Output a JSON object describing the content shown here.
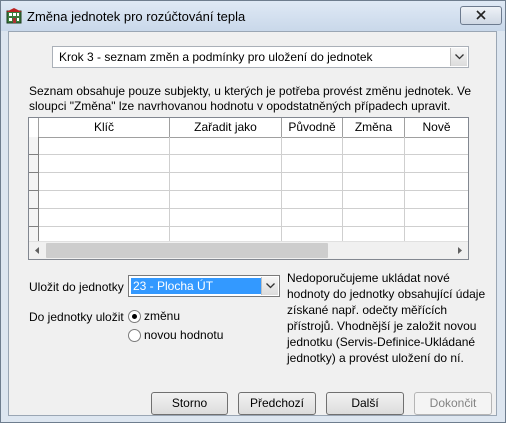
{
  "window": {
    "title": "Změna jednotek pro rozúčtování tepla",
    "close_glyph": "✕"
  },
  "step_select": {
    "value": "Krok 3 - seznam změn a podmínky pro uložení do jednotek"
  },
  "description": "Seznam obsahuje pouze subjekty, u kterých je potřeba provést změnu jednotek. Ve sloupci \"Změna\" lze navrhovanou hodnotu v opodstatněných případech upravit.",
  "grid": {
    "columns": [
      "Klíč",
      "Zařadit jako",
      "Původně",
      "Změna",
      "Nově"
    ]
  },
  "save_to": {
    "label": "Uložit do jednotky",
    "value": "23 - Plocha ÚT"
  },
  "save_mode": {
    "label": "Do jednotky uložit",
    "options": [
      "změnu",
      "novou hodnotu"
    ],
    "selected": "změnu"
  },
  "note": "Nedoporučujeme ukládat nové hodnoty do jednotky obsahující údaje získané např. odečty měřících přístrojů. Vhodnější je založit novou jednotku (Servis-Definice-Ukládané jednotky) a provést uložení do ní.",
  "buttons": {
    "storno": "Storno",
    "predchozi": "Předchozí",
    "dalsi": "Další",
    "dokoncit": "Dokončit"
  },
  "colors": {
    "selection": "#3399ff",
    "titlebar": "#c9d8ea"
  }
}
